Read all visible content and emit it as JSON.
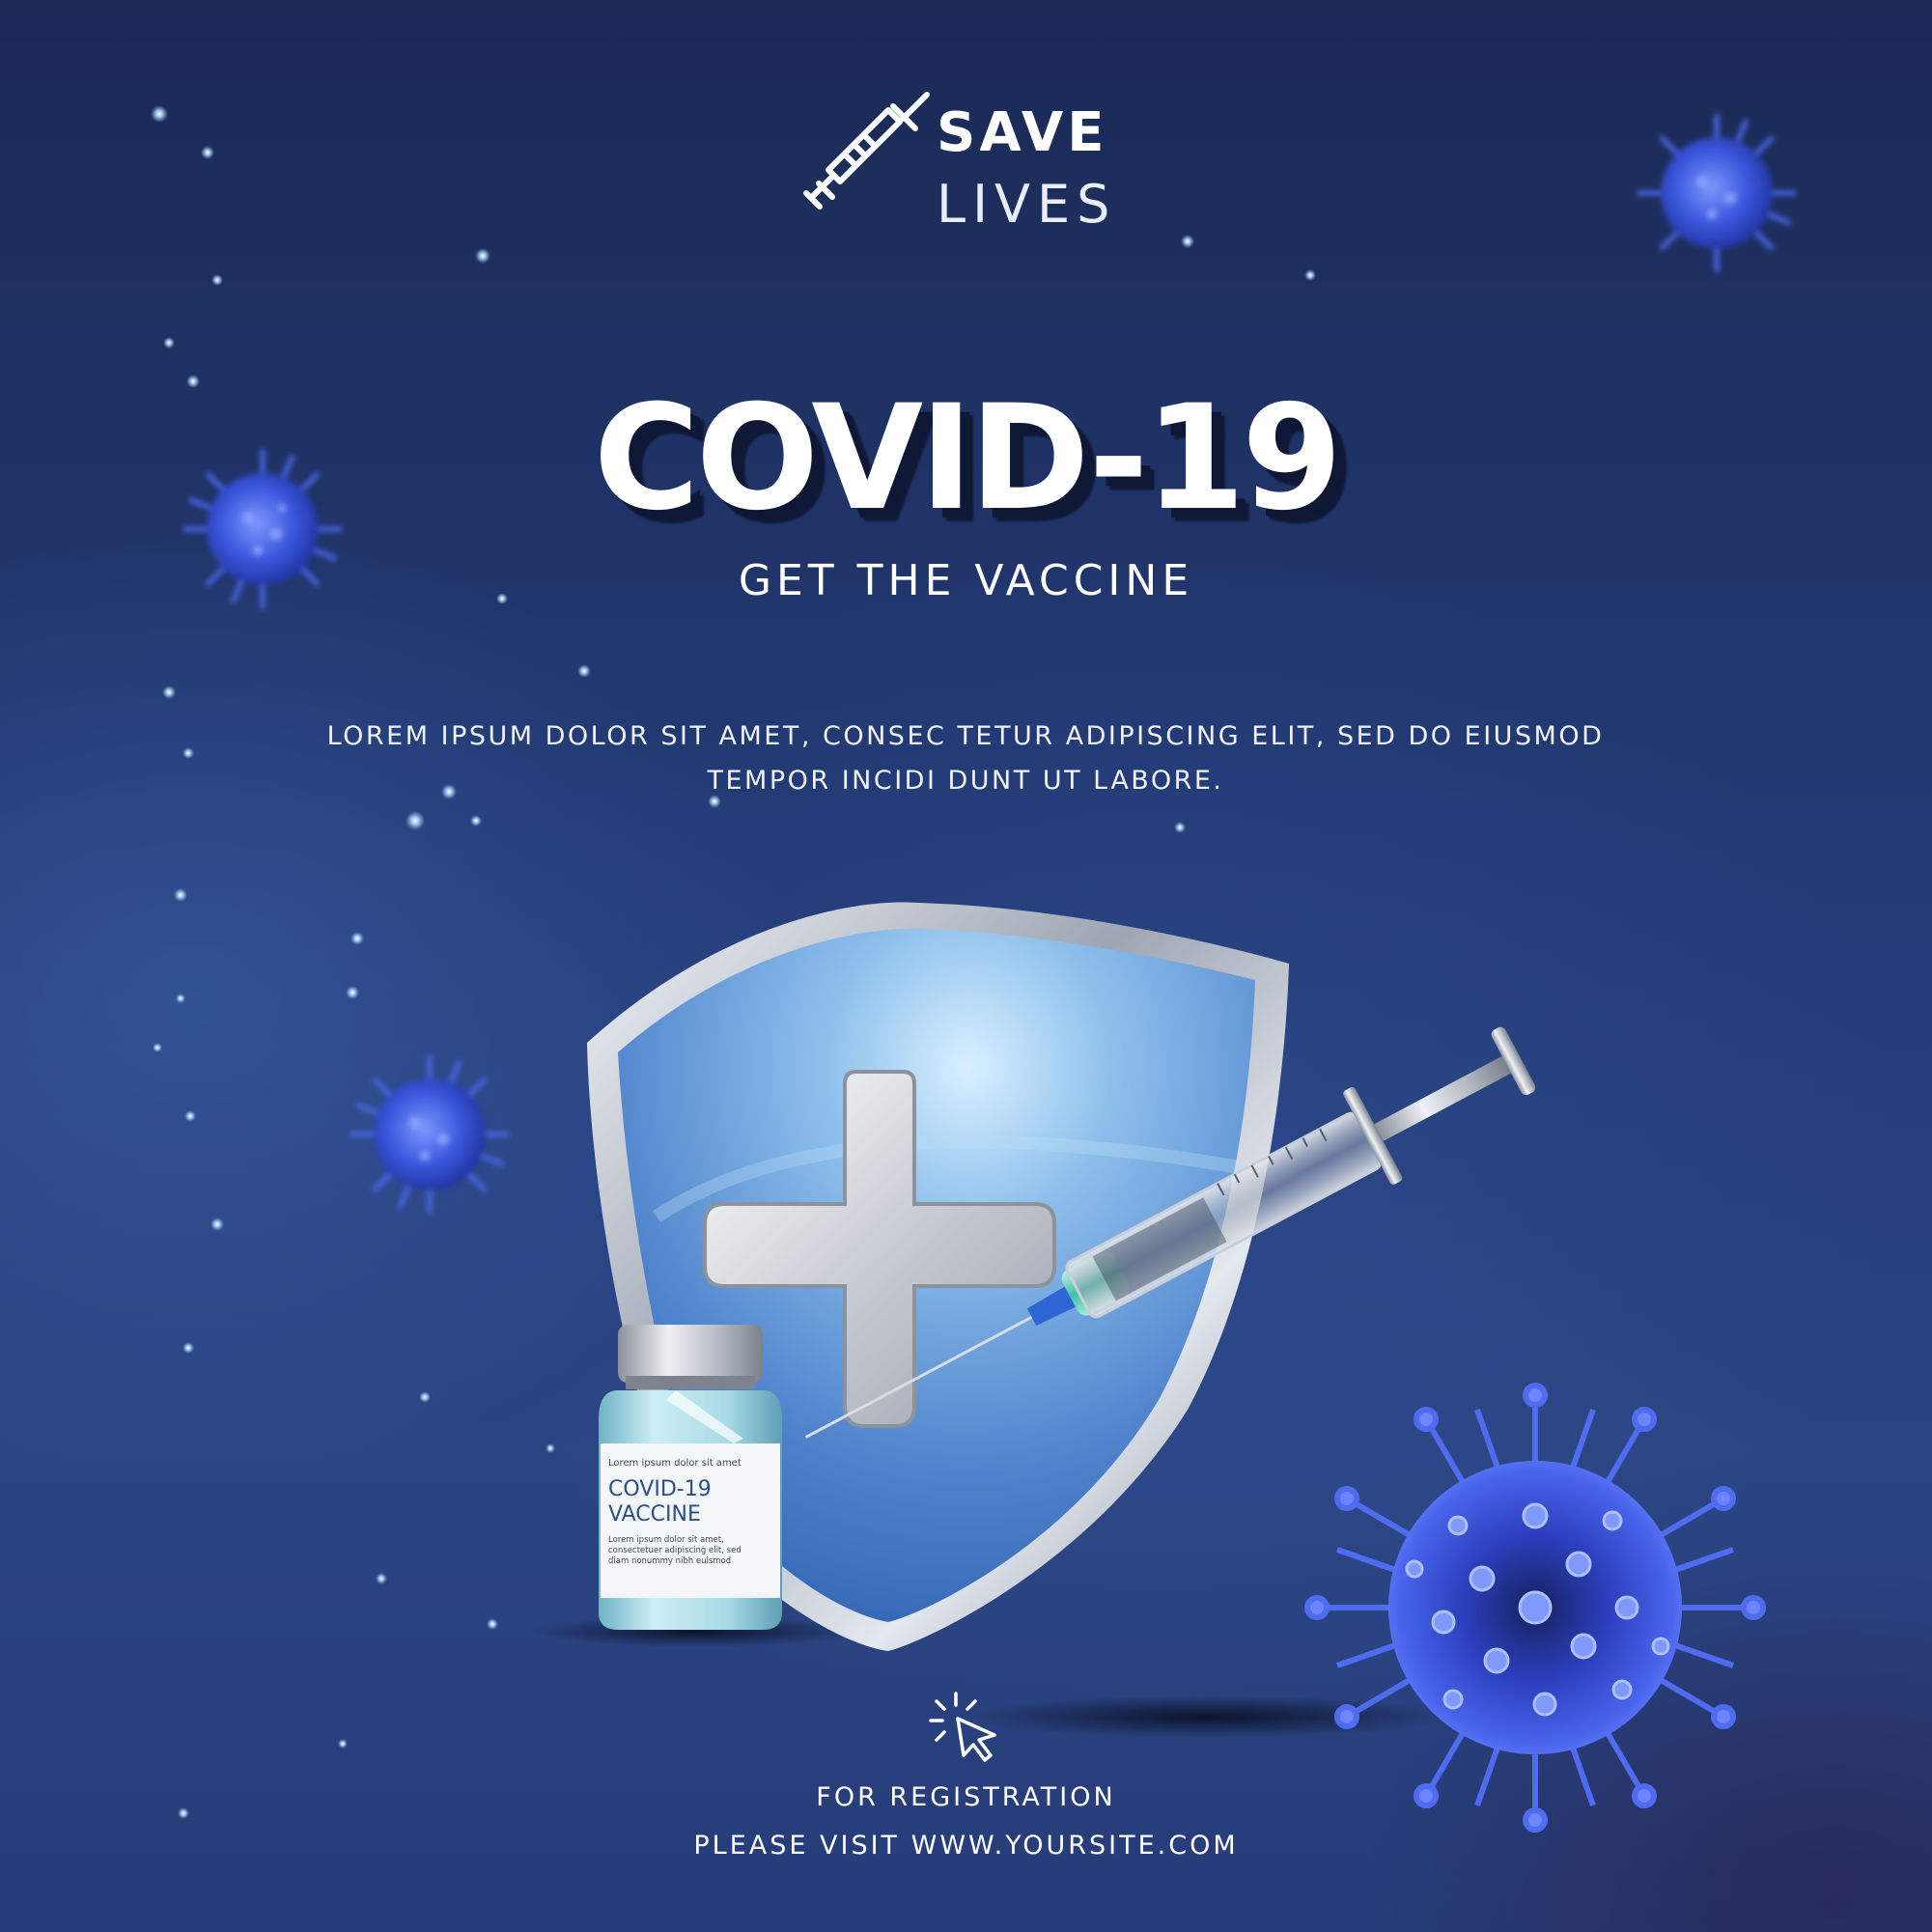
{
  "header": {
    "logo_line1": "SAVE",
    "logo_line2": "LIVES",
    "logo_icon": "syringe-icon"
  },
  "hero": {
    "title": "COVID-19",
    "subtitle": "GET THE VACCINE",
    "description": "LOREM IPSUM DOLOR SIT AMET, CONSEC TETUR ADIPISCING ELIT, SED DO EIUSMOD TEMPOR INCIDI DUNT UT LABORE."
  },
  "vial": {
    "small_text": "Lorem ipsum dolor sit amet",
    "name_line1": "COVID-19",
    "name_line2": "VACCINE",
    "body_text": "Lorem ipsum dolor sit amet, consectetuer adipiscing elit, sed diam nonummy nibh euismod"
  },
  "registration": {
    "icon": "click-cursor-icon",
    "line1": "FOR REGISTRATION",
    "line2": "PLEASE VISIT WWW.YOURSITE.COM"
  },
  "colors": {
    "background": "#233a75",
    "virus": "#3d5be0",
    "shield": "#5b8fd4",
    "text": "#ffffff"
  }
}
